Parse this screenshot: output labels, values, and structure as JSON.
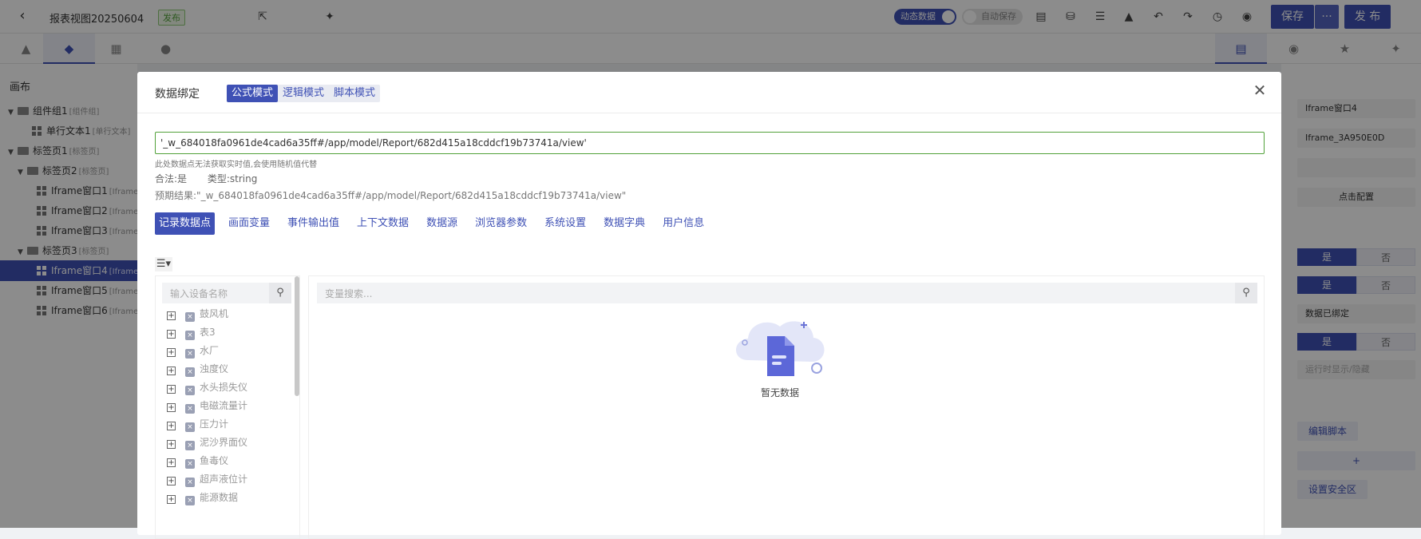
{
  "topbar": {
    "title": "报表视图20250604",
    "status_badge": "发布",
    "dynamic_toggle": "动态数据",
    "autosave_toggle": "自动保存",
    "save_label": "保存",
    "more_label": "···",
    "publish_label": "发 布"
  },
  "left_panel": {
    "heading": "画布",
    "tree": [
      {
        "label": "组件组1",
        "tag": "[组件组]"
      },
      {
        "label": "单行文本1",
        "tag": "[单行文本]"
      },
      {
        "label": "标签页1",
        "tag": "[标签页]"
      },
      {
        "label": "标签页2",
        "tag": "[标签页]"
      },
      {
        "label": "Iframe窗口1",
        "tag": "[Iframe"
      },
      {
        "label": "Iframe窗口2",
        "tag": "[Iframe"
      },
      {
        "label": "Iframe窗口3",
        "tag": "[Iframe"
      },
      {
        "label": "标签页3",
        "tag": "[标签页]"
      },
      {
        "label": "Iframe窗口4",
        "tag": "[Iframe"
      },
      {
        "label": "Iframe窗口5",
        "tag": "[Iframe"
      },
      {
        "label": "Iframe窗口6",
        "tag": "[Iframe"
      }
    ]
  },
  "right_panel": {
    "name_value": "Iframe窗口4",
    "id_value": "Iframe_3A950E0D",
    "click_config": "点击配置",
    "yes": "是",
    "no": "否",
    "bound_label": "数据已绑定",
    "runtime_label": "运行时显示/隐藏",
    "edit_script": "编辑脚本",
    "add": "+",
    "security_zone": "设置安全区"
  },
  "modal": {
    "title": "数据绑定",
    "modes": [
      "公式模式",
      "逻辑模式",
      "脚本模式"
    ],
    "formula_value": "'_w_684018fa0961de4cad6a35ff#/app/model/Report/682d415a18cddcf19b73741a/view'",
    "hint": "此处数据点无法获取实时值,会使用随机值代替",
    "valid_label": "合法:是",
    "type_label": "类型:string",
    "expected_label": "预期结果:\"_w_684018fa0961de4cad6a35ff#/app/model/Report/682d415a18cddcf19b73741a/view\"",
    "categories": [
      "记录数据点",
      "画面变量",
      "事件输出值",
      "上下文数据",
      "数据源",
      "浏览器参数",
      "系统设置",
      "数据字典",
      "用户信息"
    ],
    "device_search_placeholder": "输入设备名称",
    "devices": [
      "鼓风机",
      "表3",
      "水厂",
      "浊度仪",
      "水头损失仪",
      "电磁流量计",
      "压力计",
      "泥沙界面仪",
      "鱼毒仪",
      "超声液位计",
      "能源数据"
    ],
    "var_search_placeholder": "变量搜索...",
    "empty_text": "暂无数据"
  }
}
